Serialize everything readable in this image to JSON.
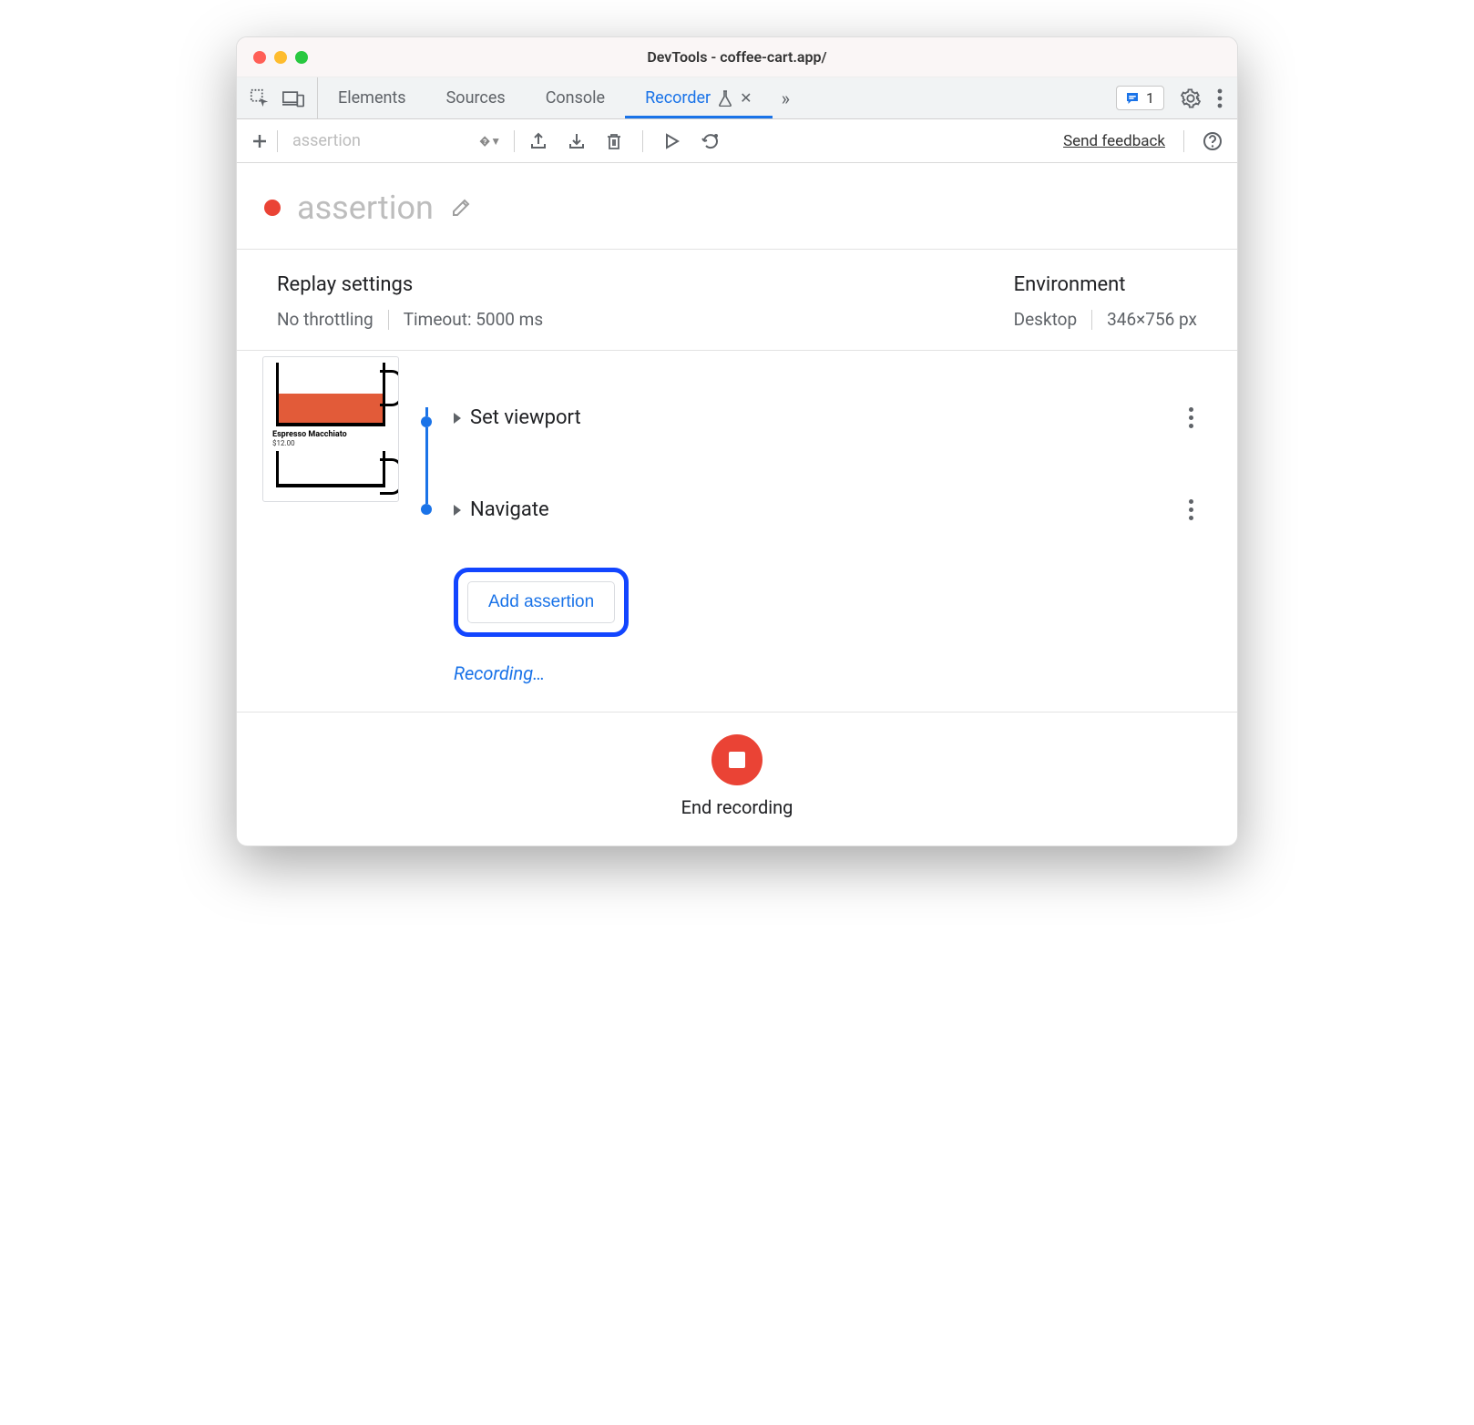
{
  "window": {
    "title": "DevTools - coffee-cart.app/"
  },
  "tabs": {
    "items": [
      "Elements",
      "Sources",
      "Console",
      "Recorder"
    ],
    "active": "Recorder"
  },
  "issues": {
    "count": "1"
  },
  "toolbar": {
    "recording_selector": "assertion",
    "send_feedback": "Send feedback"
  },
  "recording": {
    "title": "assertion"
  },
  "replay_settings": {
    "heading": "Replay settings",
    "throttling": "No throttling",
    "timeout": "Timeout: 5000 ms"
  },
  "environment": {
    "heading": "Environment",
    "device": "Desktop",
    "viewport": "346×756 px"
  },
  "thumbnail": {
    "product_name": "Espresso Macchiato",
    "product_price": "$12.00"
  },
  "steps": [
    {
      "label": "Set viewport"
    },
    {
      "label": "Navigate"
    }
  ],
  "actions": {
    "add_assertion": "Add assertion",
    "recording_status": "Recording…",
    "end_recording": "End recording"
  }
}
